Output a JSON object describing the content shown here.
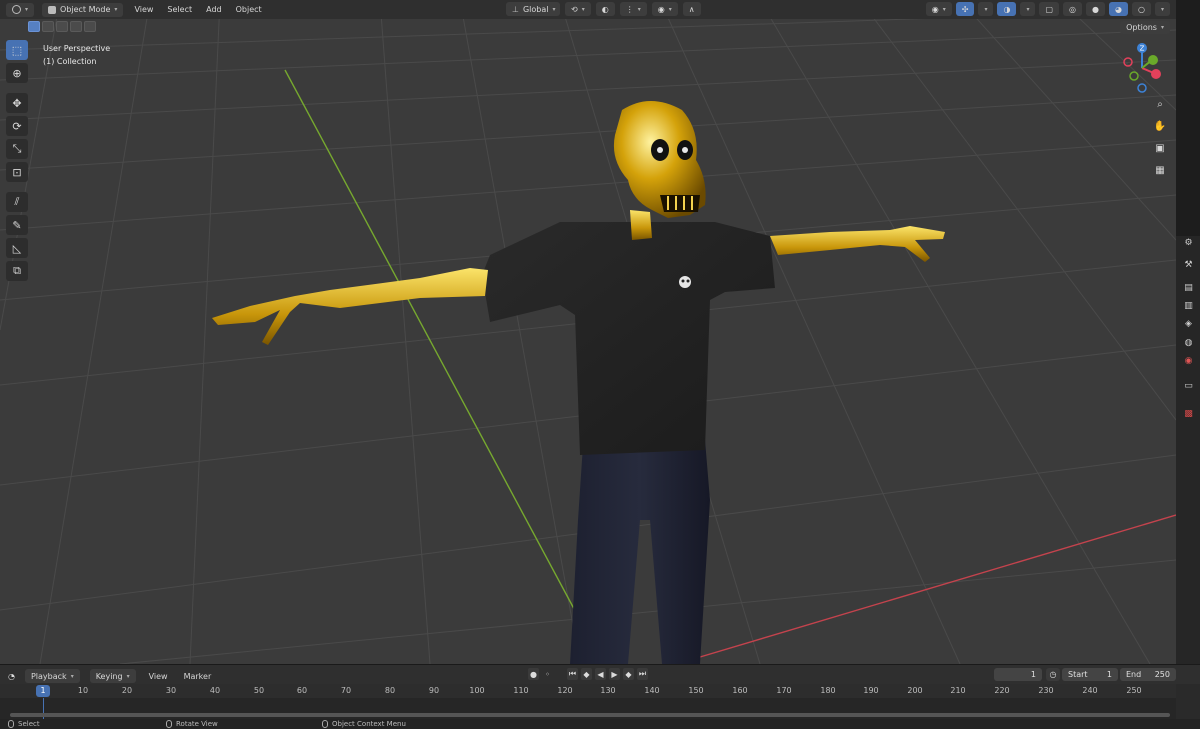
{
  "header": {
    "editor_icon": "3d-viewport-icon",
    "mode": "Object Mode",
    "menus": [
      "View",
      "Select",
      "Add",
      "Object"
    ],
    "transform_orientation": "Global",
    "options_label": "Options"
  },
  "overlay": {
    "view_name": "User Perspective",
    "collection": "(1) Collection"
  },
  "gizmo": {
    "z": "Z",
    "colors": {
      "x": "#e2415b",
      "y": "#6aa92a",
      "z": "#3d82d6"
    }
  },
  "toolbar": {
    "tools": [
      "select-box-icon",
      "cursor-icon",
      "move-icon",
      "rotate-icon",
      "scale-icon",
      "transform-icon",
      "annotate-icon",
      "measure-icon",
      "add-cube-icon"
    ]
  },
  "timeline": {
    "menus": [
      "Playback",
      "Keying",
      "View",
      "Marker"
    ],
    "current_frame": "1",
    "start_label": "Start",
    "start_value": "1",
    "end_label": "End",
    "end_value": "250",
    "ticks": [
      "10",
      "20",
      "30",
      "40",
      "50",
      "60",
      "70",
      "80",
      "90",
      "100",
      "110",
      "120",
      "130",
      "140",
      "150",
      "160",
      "170",
      "180",
      "190",
      "200",
      "210",
      "220",
      "230",
      "240",
      "250"
    ],
    "ruler_frame": "1"
  },
  "statusbar": {
    "items": [
      "Select",
      "Rotate View",
      "Object Context Menu"
    ]
  }
}
